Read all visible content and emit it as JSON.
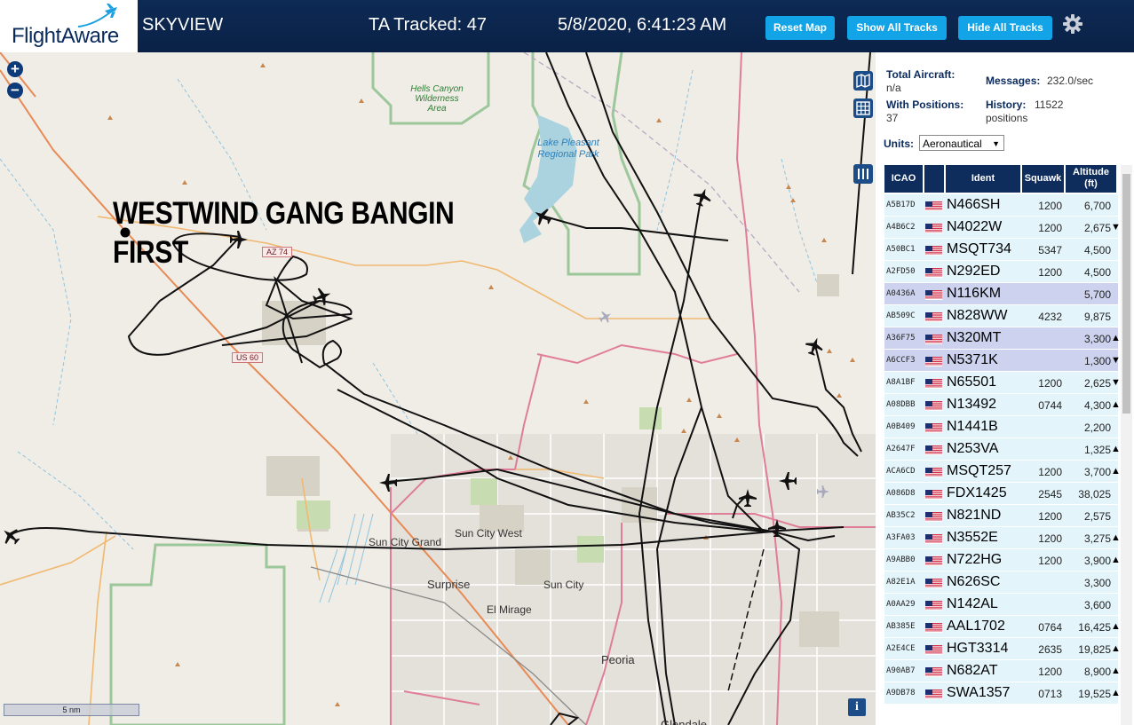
{
  "header": {
    "logo_text": "FlightAware",
    "title": "SKYVIEW",
    "tracked": "TA Tracked: 47",
    "datetime": "5/8/2020, 6:41:23 AM",
    "reset_label": "Reset Map",
    "show_label": "Show All Tracks",
    "hide_label": "Hide All Tracks"
  },
  "map": {
    "overlay_text": "WESTWIND GANG BANGIN\nFIRST",
    "scale_label": "5 nm",
    "info_label": "i",
    "zoom_in": "+",
    "zoom_out": "−",
    "labels": {
      "hells_canyon": "Hells Canyon Wilderness Area",
      "lake_pleasant": "Lake Pleasant Regional Park",
      "az74": "AZ 74",
      "us60": "US 60",
      "sun_city_grand": "Sun City Grand",
      "sun_city_west": "Sun City West",
      "surprise": "Surprise",
      "sun_city": "Sun City",
      "el_mirage": "El Mirage",
      "peoria": "Peoria",
      "glendale": "Glendale"
    }
  },
  "panel": {
    "total_label": "Total Aircraft:",
    "total_value": "n/a",
    "messages_label": "Messages:",
    "messages_value": "232.0/sec",
    "positions_label": "With Positions:",
    "positions_value": "37",
    "history_label": "History:",
    "history_value": "11522 positions",
    "units_label": "Units:",
    "units_value": "Aeronautical",
    "columns": {
      "icao": "ICAO",
      "ident": "Ident",
      "squawk": "Squawk",
      "altitude": "Altitude (ft)"
    },
    "rows": [
      {
        "icao": "A5B17D",
        "ident": "N466SH",
        "squawk": "1200",
        "alt": "6,700",
        "trend": "",
        "sel": false
      },
      {
        "icao": "A4B6C2",
        "ident": "N4022W",
        "squawk": "1200",
        "alt": "2,675",
        "trend": "▼",
        "sel": false
      },
      {
        "icao": "A50BC1",
        "ident": "MSQT734",
        "squawk": "5347",
        "alt": "4,500",
        "trend": "",
        "sel": false
      },
      {
        "icao": "A2FD50",
        "ident": "N292ED",
        "squawk": "1200",
        "alt": "4,500",
        "trend": "",
        "sel": false
      },
      {
        "icao": "A0436A",
        "ident": "N116KM",
        "squawk": "",
        "alt": "5,700",
        "trend": "",
        "sel": true
      },
      {
        "icao": "AB509C",
        "ident": "N828WW",
        "squawk": "4232",
        "alt": "9,875",
        "trend": "",
        "sel": false
      },
      {
        "icao": "A36F75",
        "ident": "N320MT",
        "squawk": "",
        "alt": "3,300",
        "trend": "▲",
        "sel": true
      },
      {
        "icao": "A6CCF3",
        "ident": "N5371K",
        "squawk": "",
        "alt": "1,300",
        "trend": "▼",
        "sel": true
      },
      {
        "icao": "A8A1BF",
        "ident": "N65501",
        "squawk": "1200",
        "alt": "2,625",
        "trend": "▼",
        "sel": false
      },
      {
        "icao": "A08DBB",
        "ident": "N13492",
        "squawk": "0744",
        "alt": "4,300",
        "trend": "▲",
        "sel": false
      },
      {
        "icao": "A0B409",
        "ident": "N1441B",
        "squawk": "",
        "alt": "2,200",
        "trend": "",
        "sel": false
      },
      {
        "icao": "A2647F",
        "ident": "N253VA",
        "squawk": "",
        "alt": "1,325",
        "trend": "▲",
        "sel": false
      },
      {
        "icao": "ACA6CD",
        "ident": "MSQT257",
        "squawk": "1200",
        "alt": "3,700",
        "trend": "▲",
        "sel": false
      },
      {
        "icao": "A086D8",
        "ident": "FDX1425",
        "squawk": "2545",
        "alt": "38,025",
        "trend": "",
        "sel": false
      },
      {
        "icao": "AB35C2",
        "ident": "N821ND",
        "squawk": "1200",
        "alt": "2,575",
        "trend": "",
        "sel": false
      },
      {
        "icao": "A3FA03",
        "ident": "N3552E",
        "squawk": "1200",
        "alt": "3,275",
        "trend": "▲",
        "sel": false
      },
      {
        "icao": "A9ABB0",
        "ident": "N722HG",
        "squawk": "1200",
        "alt": "3,900",
        "trend": "▲",
        "sel": false
      },
      {
        "icao": "A82E1A",
        "ident": "N626SC",
        "squawk": "",
        "alt": "3,300",
        "trend": "",
        "sel": false
      },
      {
        "icao": "A0AA29",
        "ident": "N142AL",
        "squawk": "",
        "alt": "3,600",
        "trend": "",
        "sel": false
      },
      {
        "icao": "AB385E",
        "ident": "AAL1702",
        "squawk": "0764",
        "alt": "16,425",
        "trend": "▲",
        "sel": false
      },
      {
        "icao": "A2E4CE",
        "ident": "HGT3314",
        "squawk": "2635",
        "alt": "19,825",
        "trend": "▲",
        "sel": false
      },
      {
        "icao": "A90AB7",
        "ident": "N682AT",
        "squawk": "1200",
        "alt": "8,900",
        "trend": "▲",
        "sel": false
      },
      {
        "icao": "A9DB78",
        "ident": "SWA1357",
        "squawk": "0713",
        "alt": "19,525",
        "trend": "▲",
        "sel": false
      }
    ]
  }
}
